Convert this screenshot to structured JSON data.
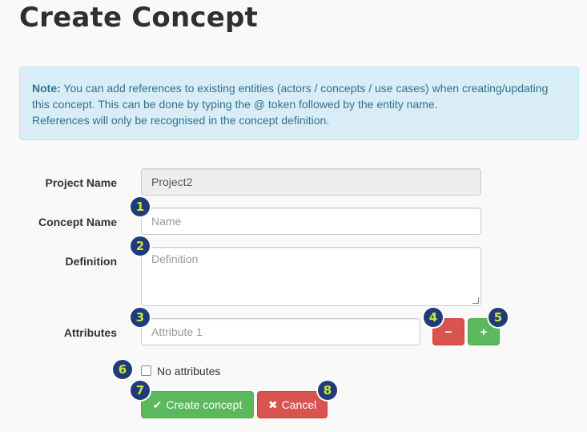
{
  "page": {
    "title": "Create Concept"
  },
  "note": {
    "prefix": "Note:",
    "text": " You can add references to existing entities (actors / concepts / use cases) when creating/updating this concept. This can be done by typing the @ token followed by the entity name.",
    "line3": "References will only be recognised in the concept definition."
  },
  "form": {
    "project_name": {
      "label": "Project Name",
      "value": "Project2"
    },
    "concept_name": {
      "label": "Concept Name",
      "placeholder": "Name"
    },
    "definition": {
      "label": "Definition",
      "placeholder": "Definition"
    },
    "attributes": {
      "label": "Attributes",
      "placeholder": "Attribute 1"
    },
    "remove_attr_glyph": "−",
    "add_attr_glyph": "+",
    "no_attributes_label": "No attributes",
    "create_label": "Create concept",
    "create_icon": "✔",
    "cancel_label": "Cancel",
    "cancel_icon": "✖"
  },
  "badges": [
    "1",
    "2",
    "3",
    "4",
    "5",
    "6",
    "7",
    "8"
  ],
  "colors": {
    "badge_bg": "#1f3b7a",
    "badge_fg": "#c8e63c",
    "success": "#5cb85c",
    "danger": "#d9534f",
    "note_bg": "#d9edf7"
  }
}
